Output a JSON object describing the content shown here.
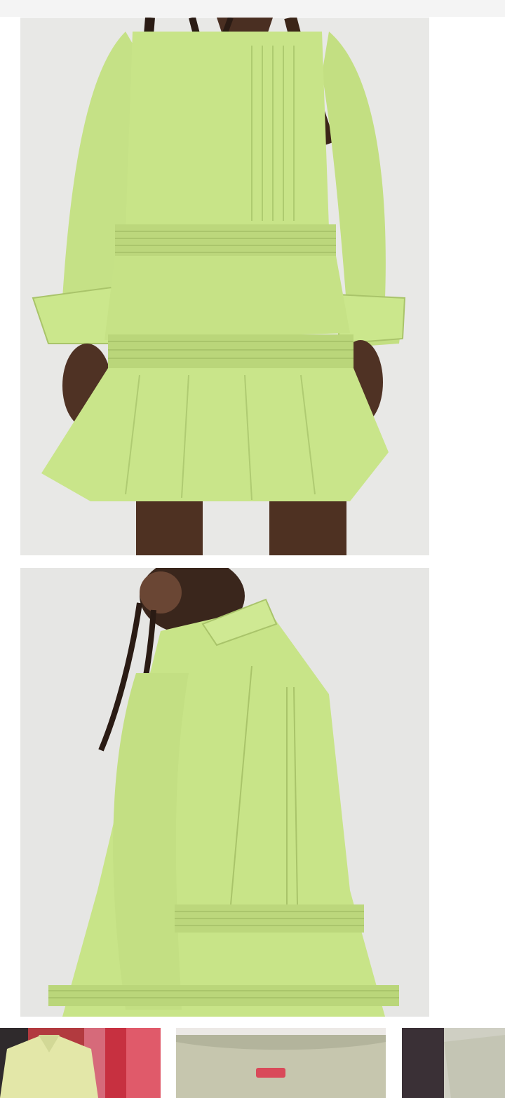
{
  "colors": {
    "background": "#ffffff",
    "photo_background": "#e7e7e5",
    "dress": "#c9e58a",
    "dress_shadow": "#a9c76a",
    "skin": "#5a3a2a",
    "hair": "#2b1d16"
  },
  "listing_photos": [
    {
      "name": "product-photo-front",
      "alt": ""
    },
    {
      "name": "product-photo-back",
      "alt": ""
    }
  ],
  "thumbnails": [
    {
      "name": "thumbnail-1"
    },
    {
      "name": "thumbnail-2"
    },
    {
      "name": "thumbnail-3"
    }
  ]
}
